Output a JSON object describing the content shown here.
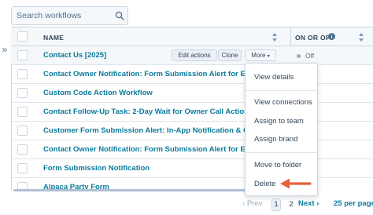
{
  "search": {
    "placeholder": "Search workflows"
  },
  "table": {
    "columns": {
      "name": "NAME",
      "status": "ON OR OFF"
    },
    "rows": [
      {
        "name": "Contact Us [2025]",
        "status": "Off"
      },
      {
        "name": "Contact Owner Notification: Form Submission Alert for Existing"
      },
      {
        "name": "Custom Code Action Workflow"
      },
      {
        "name": "Contact Follow-Up Task: 2-Day Wait for Owner Call Action"
      },
      {
        "name": "Customer Form Submission Alert: In-App Notification & Call Task"
      },
      {
        "name": "Contact Owner Notification: Form Submission Alert for Existing"
      },
      {
        "name": "Form Submission Notification"
      },
      {
        "name": "Alpaca Party Form"
      }
    ],
    "row_actions": {
      "edit": "Edit actions",
      "clone": "Clone",
      "more": "More"
    }
  },
  "more_menu": {
    "items": [
      "View details",
      "View connections",
      "Assign to team",
      "Assign brand",
      "Move to folder",
      "Delete"
    ]
  },
  "pagination": {
    "prev": "Prev",
    "pages": [
      "1",
      "2"
    ],
    "current": "1",
    "next": "Next",
    "per_page": "25 per page"
  },
  "colors": {
    "link": "#0b7a9b",
    "accent_arrow": "#e8603c",
    "header_bg": "#f5f8fa",
    "border": "#cbd6e2"
  },
  "icons": {
    "search": "search-icon",
    "sort": "sort-icon",
    "info": "info-icon",
    "expand": "double-chevron-right-icon",
    "caret": "caret-down-icon"
  }
}
